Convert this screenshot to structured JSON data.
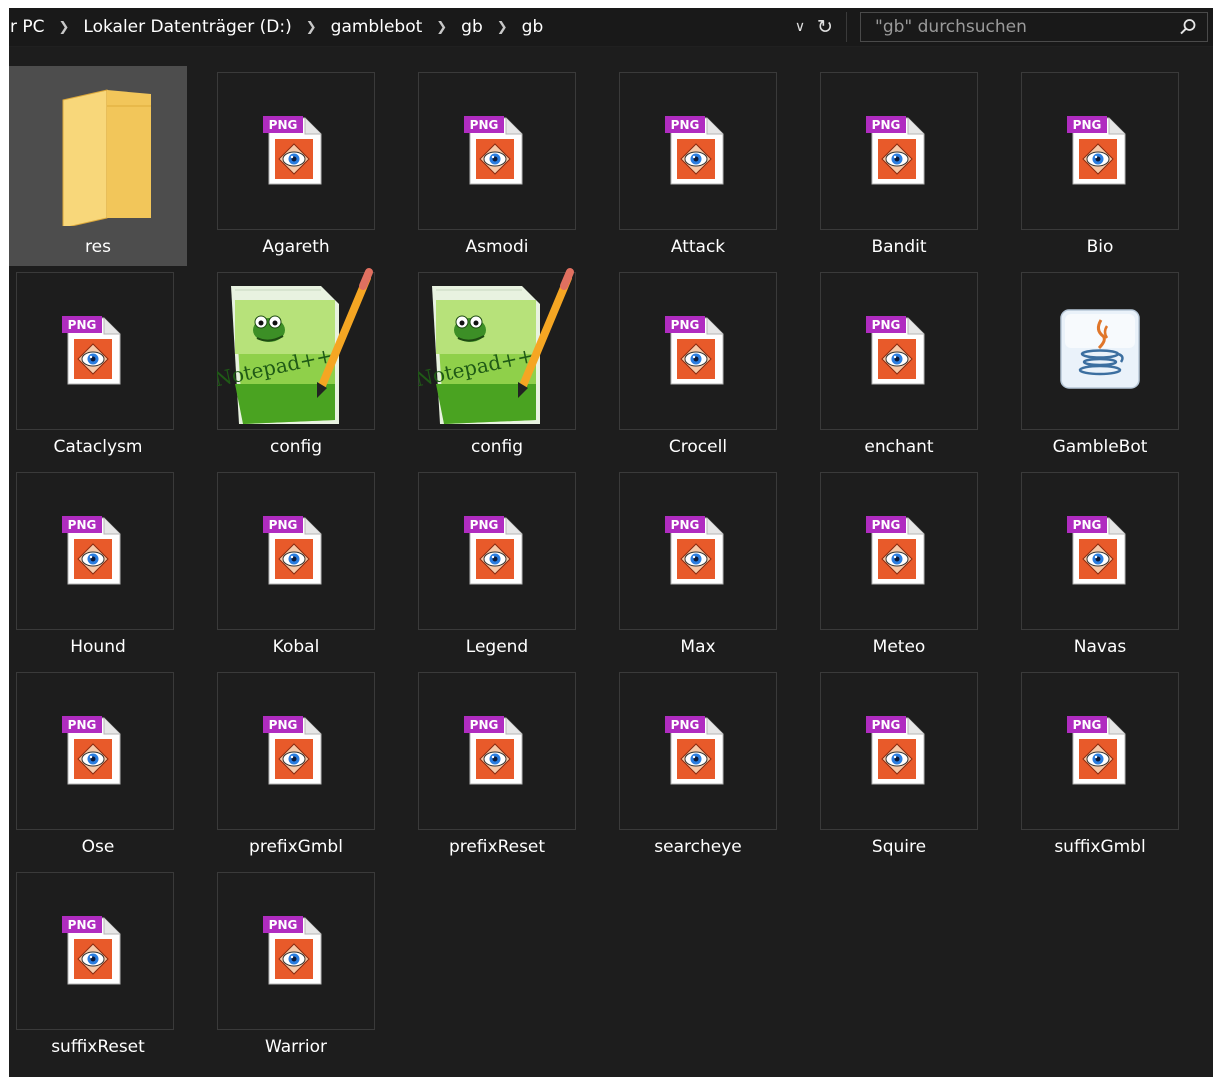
{
  "breadcrumb": {
    "items": [
      "r PC",
      "Lokaler Datenträger (D:)",
      "gamblebot",
      "gb",
      "gb"
    ]
  },
  "search": {
    "placeholder": "\"gb\" durchsuchen"
  },
  "colors": {
    "background": "#1d1d1d",
    "selected": "#4d4d4d",
    "png_badge": "#b02cc0",
    "folder": "#f5cc64"
  },
  "items": [
    {
      "name": "res",
      "type": "folder",
      "selected": true
    },
    {
      "name": "Agareth",
      "type": "png"
    },
    {
      "name": "Asmodi",
      "type": "png"
    },
    {
      "name": "Attack",
      "type": "png"
    },
    {
      "name": "Bandit",
      "type": "png"
    },
    {
      "name": "Bio",
      "type": "png"
    },
    {
      "name": "Cataclysm",
      "type": "png"
    },
    {
      "name": "config",
      "type": "notepad"
    },
    {
      "name": "config",
      "type": "notepad"
    },
    {
      "name": "Crocell",
      "type": "png"
    },
    {
      "name": "enchant",
      "type": "png"
    },
    {
      "name": "GambleBot",
      "type": "java"
    },
    {
      "name": "Hound",
      "type": "png"
    },
    {
      "name": "Kobal",
      "type": "png"
    },
    {
      "name": "Legend",
      "type": "png"
    },
    {
      "name": "Max",
      "type": "png"
    },
    {
      "name": "Meteo",
      "type": "png"
    },
    {
      "name": "Navas",
      "type": "png"
    },
    {
      "name": "Ose",
      "type": "png"
    },
    {
      "name": "prefixGmbl",
      "type": "png"
    },
    {
      "name": "prefixReset",
      "type": "png"
    },
    {
      "name": "searcheye",
      "type": "png"
    },
    {
      "name": "Squire",
      "type": "png"
    },
    {
      "name": "suffixGmbl",
      "type": "png"
    },
    {
      "name": "suffixReset",
      "type": "png"
    },
    {
      "name": "Warrior",
      "type": "png"
    }
  ],
  "badge_text": "PNG",
  "icons": {
    "png": "png-file-icon",
    "folder": "folder-icon",
    "notepad": "notepad-plus-plus-icon",
    "java": "java-icon"
  }
}
